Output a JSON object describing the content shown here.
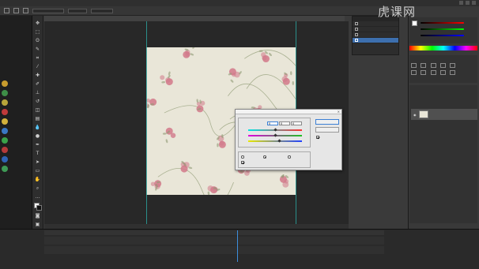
{
  "menubar": {
    "items": [
      "",
      "",
      "",
      "",
      "",
      "",
      "",
      "",
      "",
      "",
      ""
    ]
  },
  "options": {
    "field_a": "",
    "field_b": "",
    "field_c": ""
  },
  "info": {
    "rows": [
      "",
      "",
      "",
      "",
      "",
      ""
    ]
  },
  "document": {
    "tab_label": ""
  },
  "status": {
    "zoom": "",
    "doc": ""
  },
  "history": {
    "title": "",
    "items": [
      {
        "label": ""
      },
      {
        "label": ""
      },
      {
        "label": ""
      },
      {
        "label": ""
      }
    ]
  },
  "layers": {
    "layer_name": ""
  },
  "watermark": {
    "text": "虎课网"
  },
  "timeline": {
    "row1": "",
    "row2": ""
  },
  "dialog": {
    "title": "",
    "group_balance": "",
    "levels_label": "",
    "levels": [
      "0",
      "0",
      "0"
    ],
    "sliders": [
      {
        "left": "",
        "right": "",
        "value": 0.5,
        "gradient": "#00e5e5,#ff3030"
      },
      {
        "left": "",
        "right": "",
        "value": 0.5,
        "gradient": "#e000e0,#20c020"
      },
      {
        "left": "",
        "right": "",
        "value": 0.58,
        "gradient": "#e8e800,#2040ff"
      }
    ],
    "group_tone": "",
    "tone_options": [
      {
        "label": "",
        "selected": false
      },
      {
        "label": "",
        "selected": true
      },
      {
        "label": "",
        "selected": false
      }
    ],
    "preserve_luminosity": {
      "label": "",
      "checked": true
    },
    "buttons": {
      "ok": "",
      "cancel": ""
    },
    "preview": {
      "label": "",
      "checked": true
    }
  },
  "colors": {
    "accent": "#3d6fae",
    "guide": "#2aa9a4",
    "canvas_bg": "#e9e6d8",
    "rose": "#d2788a",
    "leaf": "#8f9a74"
  }
}
